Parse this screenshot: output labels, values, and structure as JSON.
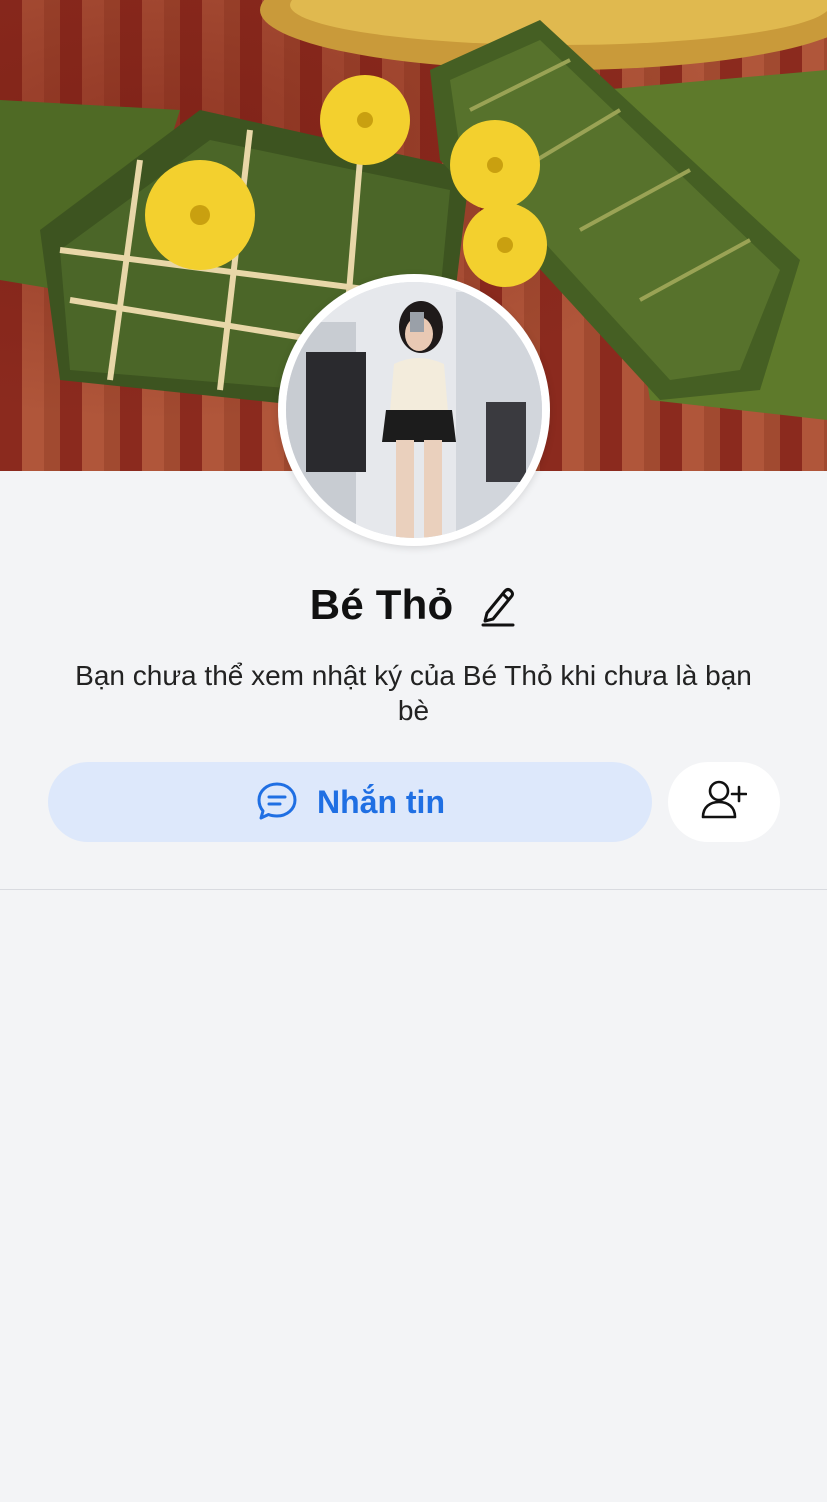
{
  "profile": {
    "name": "Bé Thỏ",
    "notice": "Bạn chưa thể xem nhật ký của Bé Thỏ khi chưa là bạn bè"
  },
  "actions": {
    "message_label": "Nhắn tin",
    "message_icon": "chat-bubble-icon",
    "add_friend_icon": "add-friend-icon",
    "edit_icon": "pencil-icon"
  },
  "colors": {
    "accent": "#1f6fe3",
    "message_button_bg": "#dde8fb",
    "page_bg": "#f3f4f6"
  }
}
